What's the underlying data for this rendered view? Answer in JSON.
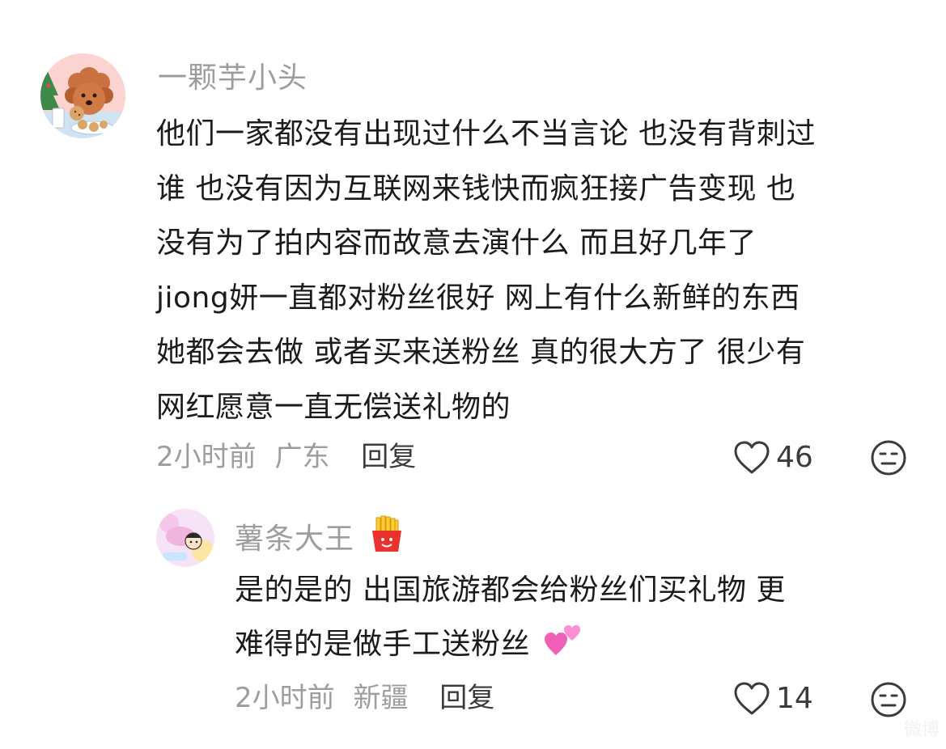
{
  "comments": [
    {
      "username": "一颗芋小头",
      "lines": [
        "他们一家都没有出现过什么不当言论 也没有背刺过",
        "谁 也没有因为互联网来钱快而疯狂接广告变现 也",
        "没有为了拍内容而故意去演什么 而且好几年了",
        "jiong妍一直都对粉丝很好 网上有什么新鲜的东西",
        "她都会去做 或者买来送粉丝 真的很大方了 很少有",
        "网红愿意一直无偿送礼物的"
      ],
      "time": "2小时前",
      "location": "广东",
      "reply_label": "回复",
      "likes": "46"
    }
  ],
  "reply": {
    "username": "薯条大王",
    "username_emoji": "fries-emoji",
    "lines": [
      "是的是的  出国旅游都会给粉丝们买礼物  更",
      "难得的是做手工送粉丝"
    ],
    "text_emoji": "two-hearts-emoji",
    "time": "2小时前",
    "location": "新疆",
    "reply_label": "回复",
    "likes": "14"
  },
  "watermark": "微博",
  "colors": {
    "text": "#1b1b1b",
    "muted": "#9d9d9d",
    "icon": "#3b3b3b",
    "heart_pink": "#f060b8"
  }
}
